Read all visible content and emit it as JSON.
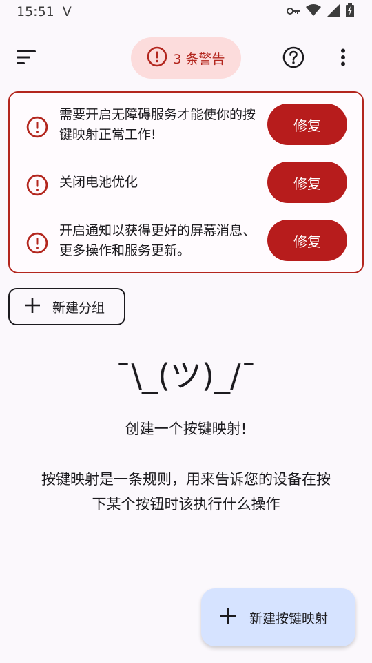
{
  "status_bar": {
    "time": "15:51",
    "v_glyph": "V",
    "icons": [
      "key-icon",
      "wifi-icon",
      "signal-icon",
      "battery-charging-icon"
    ]
  },
  "app_bar": {
    "menu_icon": "sort-menu-icon",
    "warning_chip_label": "3 条警告",
    "help_icon": "help-circle-icon",
    "more_icon": "more-vert-icon"
  },
  "warnings": [
    {
      "text": "需要开启无障碍服务才能使你的按键映射正常工作!",
      "button": "修复"
    },
    {
      "text": "关闭电池优化",
      "button": "修复"
    },
    {
      "text": "开启通知以获得更好的屏幕消息、更多操作和服务更新。",
      "button": "修复"
    }
  ],
  "new_group": {
    "label": "新建分组"
  },
  "empty_state": {
    "shrug": "¯\\_(ツ)_/¯",
    "title": "创建一个按键映射!",
    "description": "按键映射是一条规则，用来告诉您的设备在按下某个按钮时该执行什么操作"
  },
  "fab": {
    "label": "新建按键映射"
  },
  "colors": {
    "background": "#fbf8fc",
    "error": "#b3261e",
    "fix_button": "#b71c1c",
    "chip_bg": "#fcdcdc",
    "fab_bg": "#d6e3ff"
  }
}
